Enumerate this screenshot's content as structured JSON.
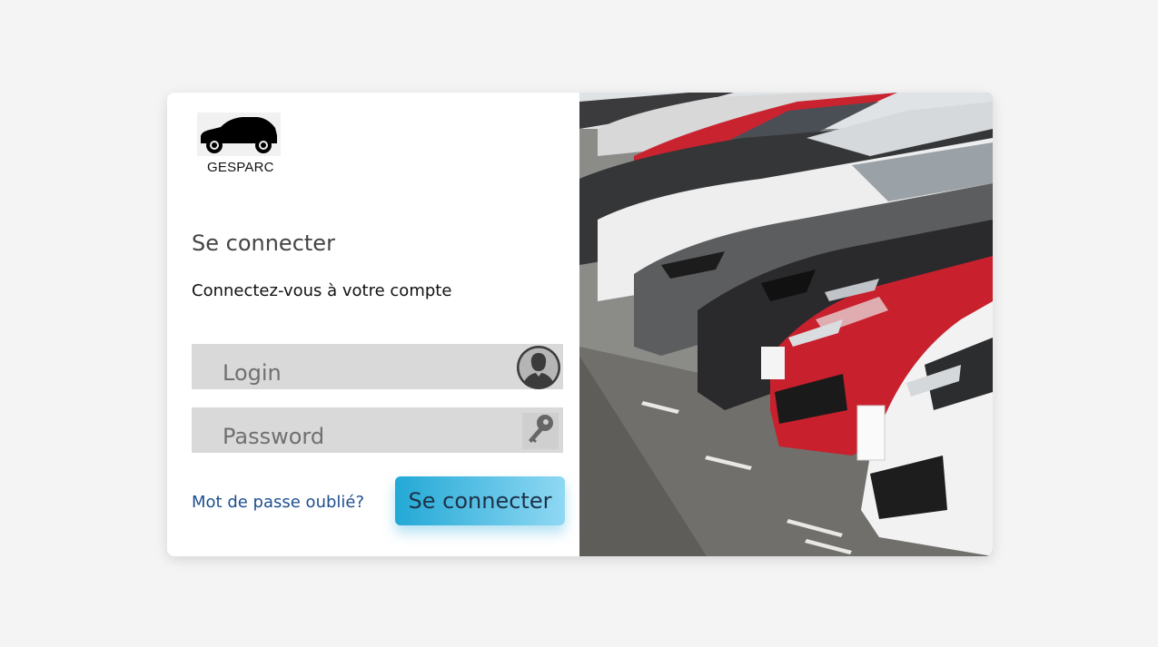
{
  "brand": {
    "name": "GESPARC",
    "logo_icon": "car-icon"
  },
  "login": {
    "title": "Se connecter",
    "subtitle": "Connectez-vous à votre compte",
    "login_placeholder": "Login",
    "login_icon": "user-icon",
    "password_placeholder": "Password",
    "password_icon": "key-icon",
    "forgot_link": "Mot de passe oublié?",
    "submit_label": "Se connecter"
  },
  "hero": {
    "image": "parked-cars-photo"
  },
  "colors": {
    "background": "#f4f4f4",
    "field": "#d9d9d9",
    "button_start": "#23a9d6",
    "button_end": "#8fd8f3",
    "link": "#1d4f8f"
  }
}
